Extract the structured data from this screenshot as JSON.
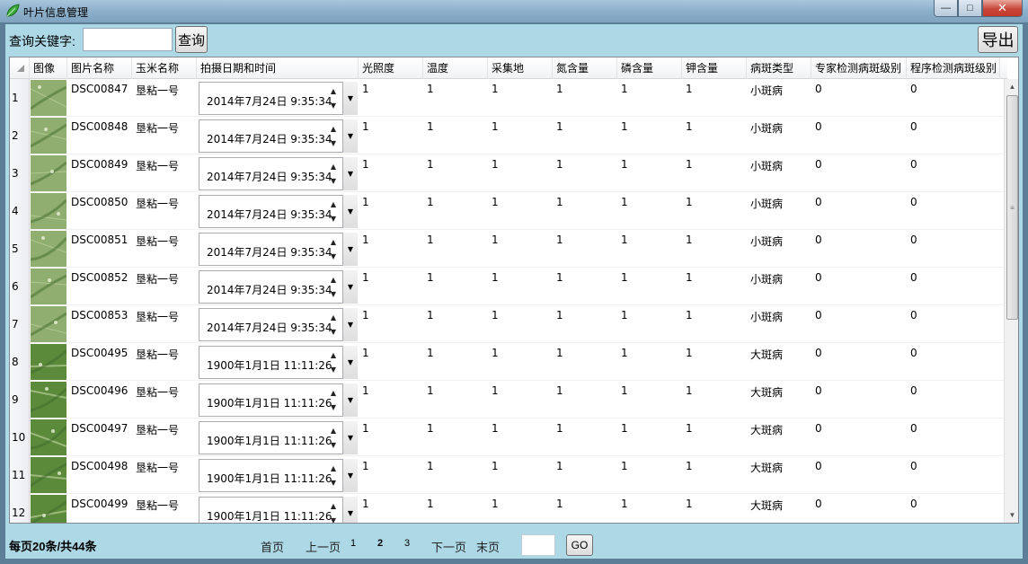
{
  "window": {
    "title": "叶片信息管理",
    "minimize": "—",
    "maximize": "□",
    "close": "✕"
  },
  "toolbar": {
    "search_label": "查询关键字:",
    "search_value": "",
    "search_button": "查询",
    "export_button": "导出"
  },
  "grid": {
    "columns": [
      "图像",
      "图片名称",
      "玉米名称",
      "拍摄日期和时间",
      "光照度",
      "温度",
      "采集地",
      "氮含量",
      "磷含量",
      "钾含量",
      "病斑类型",
      "专家检测病斑级别",
      "程序检测病斑级别"
    ],
    "rows": [
      {
        "n": "1",
        "img": "DSC00847",
        "corn": "垦粘一号",
        "datetime": "2014年7月24日  9:35:34",
        "light": "1",
        "temp": "1",
        "site": "1",
        "nitrogen": "1",
        "phosphorus": "1",
        "potassium": "1",
        "type": "小斑病",
        "expert": "0",
        "program": "0"
      },
      {
        "n": "2",
        "img": "DSC00848",
        "corn": "垦粘一号",
        "datetime": "2014年7月24日  9:35:34",
        "light": "1",
        "temp": "1",
        "site": "1",
        "nitrogen": "1",
        "phosphorus": "1",
        "potassium": "1",
        "type": "小斑病",
        "expert": "0",
        "program": "0"
      },
      {
        "n": "3",
        "img": "DSC00849",
        "corn": "垦粘一号",
        "datetime": "2014年7月24日  9:35:34",
        "light": "1",
        "temp": "1",
        "site": "1",
        "nitrogen": "1",
        "phosphorus": "1",
        "potassium": "1",
        "type": "小斑病",
        "expert": "0",
        "program": "0"
      },
      {
        "n": "4",
        "img": "DSC00850",
        "corn": "垦粘一号",
        "datetime": "2014年7月24日  9:35:34",
        "light": "1",
        "temp": "1",
        "site": "1",
        "nitrogen": "1",
        "phosphorus": "1",
        "potassium": "1",
        "type": "小斑病",
        "expert": "0",
        "program": "0"
      },
      {
        "n": "5",
        "img": "DSC00851",
        "corn": "垦粘一号",
        "datetime": "2014年7月24日  9:35:34",
        "light": "1",
        "temp": "1",
        "site": "1",
        "nitrogen": "1",
        "phosphorus": "1",
        "potassium": "1",
        "type": "小斑病",
        "expert": "0",
        "program": "0"
      },
      {
        "n": "6",
        "img": "DSC00852",
        "corn": "垦粘一号",
        "datetime": "2014年7月24日  9:35:34",
        "light": "1",
        "temp": "1",
        "site": "1",
        "nitrogen": "1",
        "phosphorus": "1",
        "potassium": "1",
        "type": "小斑病",
        "expert": "0",
        "program": "0"
      },
      {
        "n": "7",
        "img": "DSC00853",
        "corn": "垦粘一号",
        "datetime": "2014年7月24日  9:35:34",
        "light": "1",
        "temp": "1",
        "site": "1",
        "nitrogen": "1",
        "phosphorus": "1",
        "potassium": "1",
        "type": "小斑病",
        "expert": "0",
        "program": "0"
      },
      {
        "n": "8",
        "img": "DSC00495",
        "corn": "垦粘一号",
        "datetime": "1900年1月1日  11:11:26",
        "light": "1",
        "temp": "1",
        "site": "1",
        "nitrogen": "1",
        "phosphorus": "1",
        "potassium": "1",
        "type": "大斑病",
        "expert": "0",
        "program": "0"
      },
      {
        "n": "9",
        "img": "DSC00496",
        "corn": "垦粘一号",
        "datetime": "1900年1月1日  11:11:26",
        "light": "1",
        "temp": "1",
        "site": "1",
        "nitrogen": "1",
        "phosphorus": "1",
        "potassium": "1",
        "type": "大斑病",
        "expert": "0",
        "program": "0"
      },
      {
        "n": "10",
        "img": "DSC00497",
        "corn": "垦粘一号",
        "datetime": "1900年1月1日  11:11:26",
        "light": "1",
        "temp": "1",
        "site": "1",
        "nitrogen": "1",
        "phosphorus": "1",
        "potassium": "1",
        "type": "大斑病",
        "expert": "0",
        "program": "0"
      },
      {
        "n": "11",
        "img": "DSC00498",
        "corn": "垦粘一号",
        "datetime": "1900年1月1日  11:11:26",
        "light": "1",
        "temp": "1",
        "site": "1",
        "nitrogen": "1",
        "phosphorus": "1",
        "potassium": "1",
        "type": "大斑病",
        "expert": "0",
        "program": "0"
      },
      {
        "n": "12",
        "img": "DSC00499",
        "corn": "垦粘一号",
        "datetime": "1900年1月1日  11:11:26",
        "light": "1",
        "temp": "1",
        "site": "1",
        "nitrogen": "1",
        "phosphorus": "1",
        "potassium": "1",
        "type": "大斑病",
        "expert": "0",
        "program": "0"
      }
    ]
  },
  "footer": {
    "page_info": "每页20条/共44条",
    "first": "首页",
    "prev": "上一页",
    "pages": [
      "1",
      "2",
      "3"
    ],
    "current_page": "2",
    "next": "下一页",
    "last": "末页",
    "goto_value": "",
    "go": "GO"
  },
  "colors": {
    "client_bg": "#add8e6",
    "small_leaf": "#8fae6f",
    "big_leaf": "#5a8a3a"
  }
}
